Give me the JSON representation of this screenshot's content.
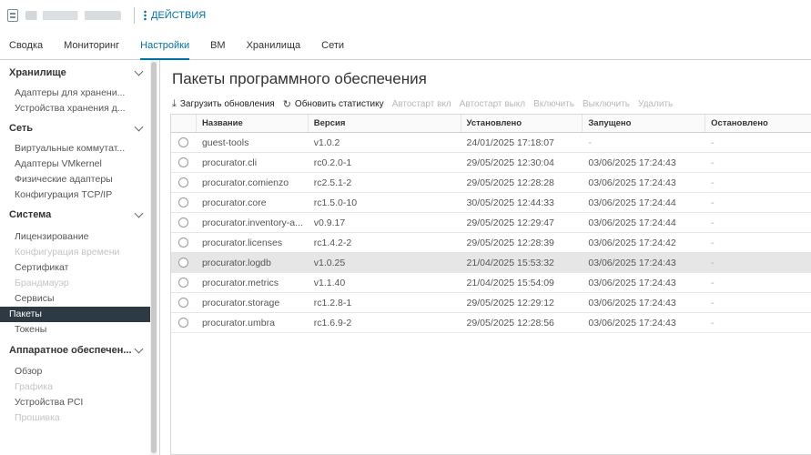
{
  "header": {
    "actions_label": "ДЕЙСТВИЯ"
  },
  "tabs": [
    {
      "label": "Сводка"
    },
    {
      "label": "Мониторинг"
    },
    {
      "label": "Настройки",
      "active": true
    },
    {
      "label": "ВМ"
    },
    {
      "label": "Хранилища"
    },
    {
      "label": "Сети"
    }
  ],
  "sidebar": {
    "sections": [
      {
        "title": "Хранилище",
        "items": [
          "Адаптеры для хранени...",
          "Устройства хранения д..."
        ]
      },
      {
        "title": "Сеть",
        "items": [
          "Виртуальные коммутат...",
          "Адаптеры VMkernel",
          "Физические адаптеры",
          "Конфигурация TCP/IP"
        ]
      },
      {
        "title": "Система",
        "items": [
          "Лицензирование",
          "Конфигурация времени",
          "Сертификат",
          "Брандмауэр",
          "Сервисы",
          "Пакеты",
          "Токены"
        ]
      },
      {
        "title": "Аппаратное обеспечен...",
        "items": [
          "Обзор",
          "Графика",
          "Устройства PCI",
          "Прошивка"
        ]
      }
    ]
  },
  "main": {
    "title": "Пакеты программного обеспечения",
    "toolbar": {
      "upload": "Загрузить обновления",
      "refresh": "Обновить статистику",
      "autostart_on": "Автостарт вкл",
      "autostart_off": "Автостарт выкл",
      "enable": "Включить",
      "disable": "Выключить",
      "delete": "Удалить"
    },
    "columns": [
      "Название",
      "Версия",
      "Установлено",
      "Запущено",
      "Остановлено"
    ],
    "rows": [
      {
        "name": "guest-tools",
        "version": "v1.0.2",
        "installed": "24/01/2025 17:18:07",
        "started": "-",
        "stopped": "-"
      },
      {
        "name": "procurator.cli",
        "version": "rc0.2.0-1",
        "installed": "29/05/2025 12:30:04",
        "started": "03/06/2025 17:24:43",
        "stopped": "-"
      },
      {
        "name": "procurator.comienzo",
        "version": "rc2.5.1-2",
        "installed": "29/05/2025 12:28:28",
        "started": "03/06/2025 17:24:43",
        "stopped": "-"
      },
      {
        "name": "procurator.core",
        "version": "rc1.5.0-10",
        "installed": "30/05/2025 12:44:33",
        "started": "03/06/2025 17:24:44",
        "stopped": "-"
      },
      {
        "name": "procurator.inventory-a...",
        "version": "v0.9.17",
        "installed": "29/05/2025 12:29:47",
        "started": "03/06/2025 17:24:44",
        "stopped": "-"
      },
      {
        "name": "procurator.licenses",
        "version": "rc1.4.2-2",
        "installed": "29/05/2025 12:28:39",
        "started": "03/06/2025 17:24:42",
        "stopped": "-"
      },
      {
        "name": "procurator.logdb",
        "version": "v1.0.25",
        "installed": "21/04/2025 15:53:32",
        "started": "03/06/2025 17:24:43",
        "stopped": "-"
      },
      {
        "name": "procurator.metrics",
        "version": "v1.1.40",
        "installed": "21/04/2025 15:54:09",
        "started": "03/06/2025 17:24:43",
        "stopped": "-"
      },
      {
        "name": "procurator.storage",
        "version": "rc1.2.8-1",
        "installed": "29/05/2025 12:29:12",
        "started": "03/06/2025 17:24:43",
        "stopped": "-"
      },
      {
        "name": "procurator.umbra",
        "version": "rc1.6.9-2",
        "installed": "29/05/2025 12:28:56",
        "started": "03/06/2025 17:24:43",
        "stopped": "-"
      }
    ]
  },
  "colors": {
    "accent": "#0072a3",
    "selected_nav_bg": "#2d3a44"
  }
}
